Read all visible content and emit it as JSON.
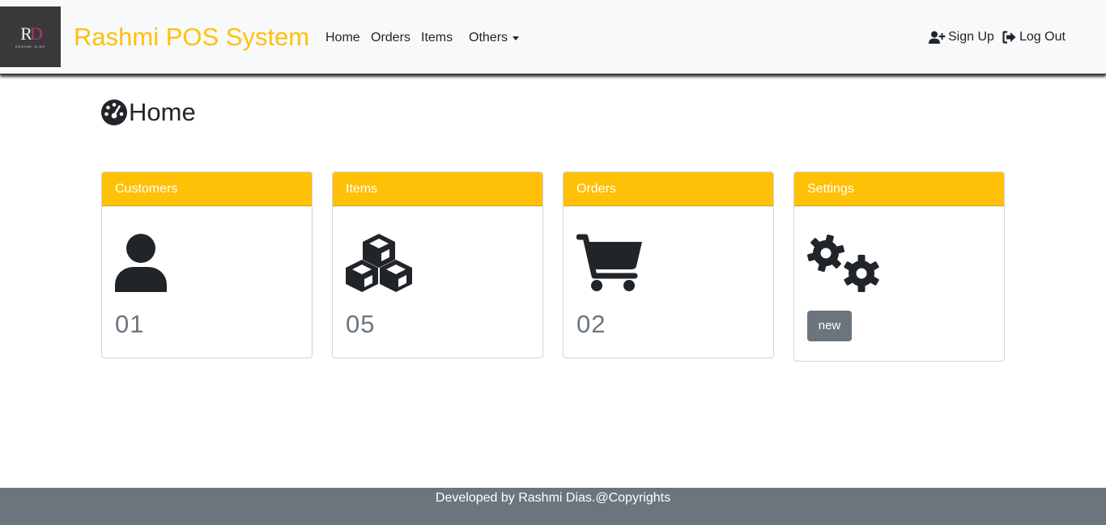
{
  "app": {
    "brand": "Rashmi POS System",
    "logo_text": "RD",
    "logo_subtext": "RASHMI DIAS"
  },
  "nav": {
    "home": "Home",
    "orders": "Orders",
    "items": "Items",
    "others": "Others",
    "sign_up": "Sign Up",
    "log_out": "Log Out"
  },
  "page": {
    "title": "Home",
    "title_icon": "gauge-icon"
  },
  "cards": [
    {
      "title": "Customers",
      "icon": "user-icon",
      "count": "01"
    },
    {
      "title": "Items",
      "icon": "cubes-icon",
      "count": "05"
    },
    {
      "title": "Orders",
      "icon": "cart-icon",
      "count": "02"
    },
    {
      "title": "Settings",
      "icon": "gears-icon",
      "button": "new"
    }
  ],
  "footer": {
    "text": "Developed by Rashmi Dias.@Copyrights"
  },
  "colors": {
    "accent": "#ffc107",
    "secondary": "#6c757d",
    "navbar_bg": "#f8f9fa",
    "text_dark": "#212529"
  }
}
